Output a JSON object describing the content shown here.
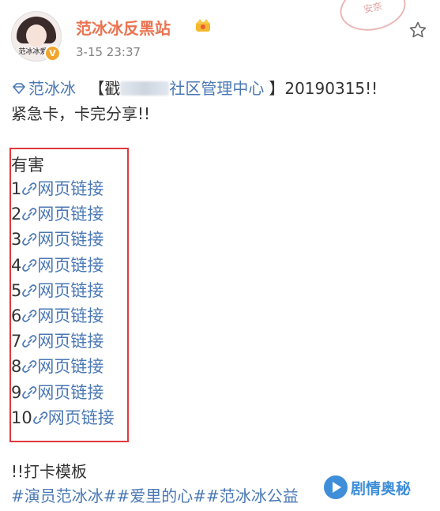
{
  "post": {
    "username": "范冰冰反黑站",
    "timestamp": "3-15 23:37",
    "avatar_caption": "范冰冰爱好",
    "stamp_text": "安奈",
    "mention_text": "范冰冰",
    "bracket_open": "【戳",
    "bracket_rest": "社区管理中心",
    "bracket_close": "】20190315!!",
    "line2": "紧急卡，卡完分享!!",
    "harm_title": "有害",
    "link_label": "网页链接",
    "items": [
      "1",
      "2",
      "3",
      "4",
      "5",
      "6",
      "7",
      "8",
      "9",
      "10"
    ],
    "template_label": "!!打卡模板",
    "hashtags": "#演员范冰冰##爱里的心##范冰冰公益"
  },
  "watermark": {
    "text": "剧情奥秘"
  },
  "icons": {
    "verified": "verified-badge-icon",
    "crown": "crown-icon",
    "favorite": "star-outline-icon",
    "mention": "diamond-mention-icon",
    "link": "chain-link-icon"
  },
  "colors": {
    "username": "#eb7350",
    "link": "#4a78b5",
    "highlight_box": "#e0393e",
    "watermark": "#3e8ed9"
  }
}
